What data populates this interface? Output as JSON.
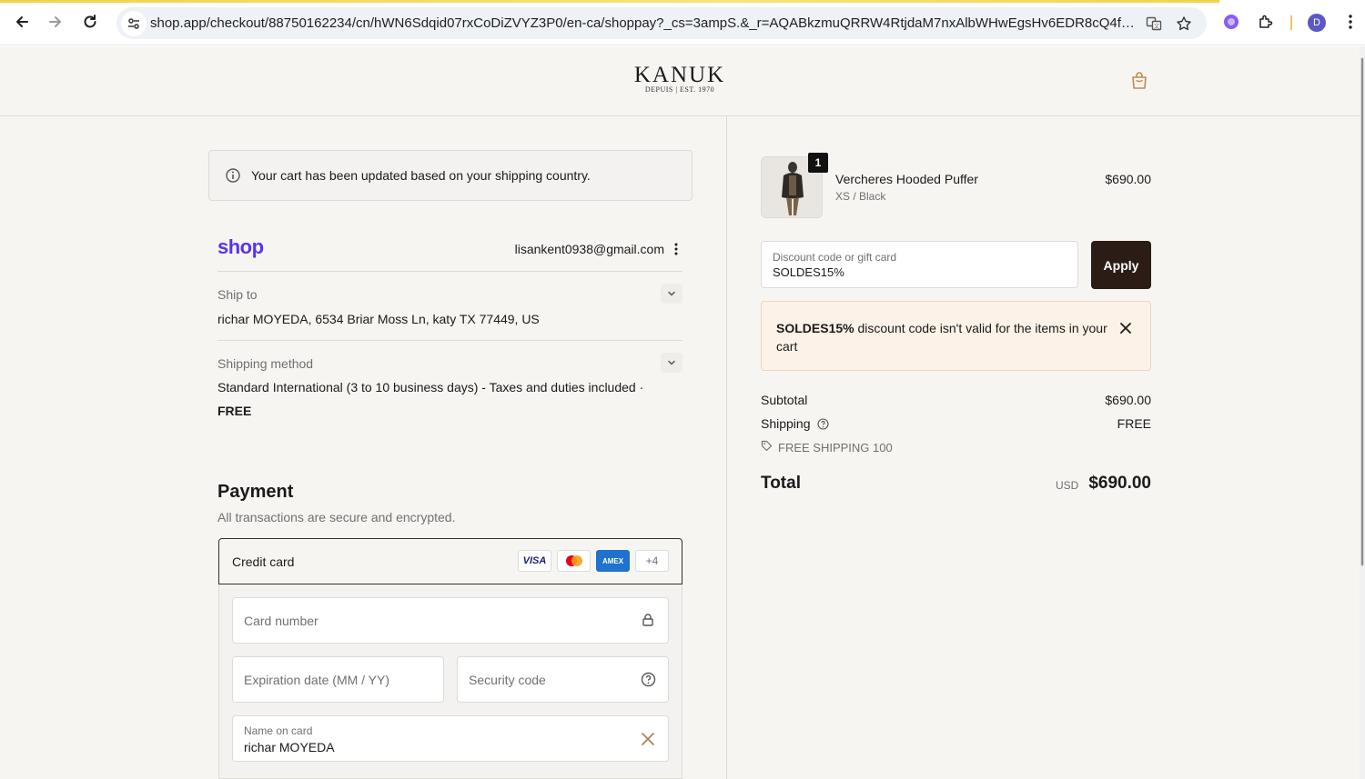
{
  "browser": {
    "url": "shop.app/checkout/88750162234/cn/hWN6Sdqid07rxCoDiZVYZ3P0/en-ca/shoppay?_cs=3ampS.&_r=AQABkzmuQRRW4RtjdaM7nxAlbWHwEgsHv6EDR8cQ4flrPk0&r...",
    "profile_initial": "D",
    "icons": [
      "back-icon",
      "forward-icon",
      "reload-icon",
      "site-settings-icon",
      "translate-icon",
      "bookmark-star-icon",
      "extension-icon",
      "puzzle-icon",
      "menu-icon"
    ]
  },
  "header": {
    "brand": "KANUK",
    "tagline": "DEPUIS | EST. 1970",
    "cart_icon": "shopping-bag-icon"
  },
  "notice": {
    "text": "Your cart has been updated based on your shipping country."
  },
  "account": {
    "shop_logo": "shop",
    "email": "lisankent0938@gmail.com"
  },
  "ship_to": {
    "label": "Ship to",
    "value": "richar MOYEDA, 6534 Briar Moss Ln, katy TX 77449, US"
  },
  "shipping_method": {
    "label": "Shipping method",
    "value": "Standard International (3 to 10 business days) - Taxes and duties included ·",
    "price": "FREE"
  },
  "payment": {
    "title": "Payment",
    "subtitle": "All transactions are secure and encrypted.",
    "method_label": "Credit card",
    "card_logos": [
      "VISA",
      "mastercard",
      "AMEX"
    ],
    "more_cards": "+4",
    "card_number_placeholder": "Card number",
    "expiry_placeholder": "Expiration date (MM / YY)",
    "security_placeholder": "Security code",
    "name_label": "Name on card",
    "name_value": "richar MOYEDA"
  },
  "order": {
    "item": {
      "quantity": "1",
      "name": "Vercheres Hooded Puffer",
      "variant": "XS / Black",
      "price": "$690.00"
    },
    "discount": {
      "label": "Discount code or gift card",
      "value": "SOLDES15%",
      "apply_label": "Apply"
    },
    "error": {
      "code": "SOLDES15%",
      "message": " discount code isn't valid for the items in your cart"
    },
    "summary": {
      "subtotal_label": "Subtotal",
      "subtotal_value": "$690.00",
      "shipping_label": "Shipping",
      "shipping_value": "FREE",
      "shipping_code": "FREE SHIPPING 100",
      "total_label": "Total",
      "total_currency": "USD",
      "total_value": "$690.00"
    }
  },
  "colors": {
    "page_bg": "#f7f5f2",
    "shop_purple": "#5a31f4",
    "apply_bg": "#2b1d15",
    "warning_bg": "#fdf2e7"
  }
}
